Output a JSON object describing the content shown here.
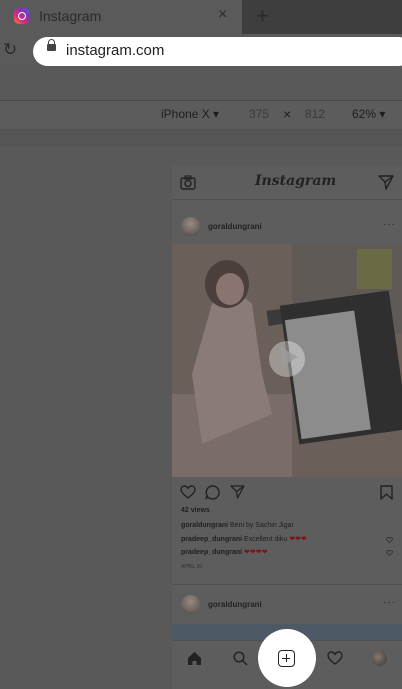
{
  "browser": {
    "tab_title": "Instagram",
    "tab_close": "×",
    "new_tab": "+",
    "reload": "↻",
    "url": "instagram.com"
  },
  "devtools": {
    "device": "iPhone X",
    "width": "375",
    "times": "×",
    "height": "812",
    "zoom": "62%"
  },
  "instagram": {
    "logo": "Instagram",
    "post1": {
      "username": "goraldungrani",
      "more": "···",
      "views": "42 views",
      "caption_user": "goraldungrani",
      "caption_text": "Beni by Sachin Jigar",
      "comments": [
        {
          "user": "pradeep_dungrani",
          "text": "Excellent diku",
          "hearts": "❤❤❤"
        },
        {
          "user": "pradeep_dungrani",
          "text": "",
          "hearts": "❤❤❤❤"
        }
      ],
      "date": "APRIL 20"
    },
    "post2": {
      "username": "goraldungrani",
      "more": "···"
    }
  },
  "colors": {
    "overlay": "#595959",
    "highlight": "#ffffff",
    "hearts": "#7a1414"
  },
  "icons": [
    "camera-icon",
    "direct-icon",
    "heart-icon",
    "comment-icon",
    "share-icon",
    "bookmark-icon",
    "play-icon",
    "home-icon",
    "search-icon",
    "new-post-icon",
    "activity-icon",
    "profile-icon"
  ]
}
